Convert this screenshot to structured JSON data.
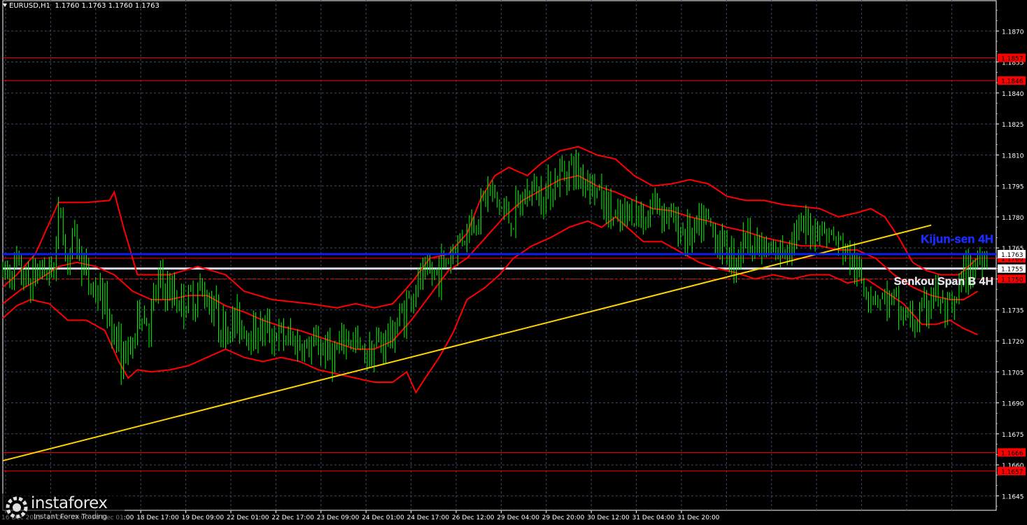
{
  "header": {
    "symbol": "EURUSD,H1",
    "ohlc": "1.1760 1.1763 1.1760 1.1763"
  },
  "watermark": {
    "brand": "instaforex",
    "tagline": "Instant Forex Trading"
  },
  "chart_data": {
    "type": "candlestick",
    "symbol": "EURUSD",
    "timeframe": "H1",
    "ylim": [
      1.1638,
      1.1885
    ],
    "y_ticks": [
      "1.1870",
      "1.1855",
      "1.1840",
      "1.1825",
      "1.1810",
      "1.1795",
      "1.1780",
      "1.1765",
      "1.1750",
      "1.1735",
      "1.1720",
      "1.1705",
      "1.1690",
      "1.1675",
      "1.1660",
      "1.1645"
    ],
    "x_ticks": [
      "16 Dec 2025",
      "17 Dec 09:00",
      "18 Dec 01:00",
      "18 Dec 17:00",
      "19 Dec 09:00",
      "22 Dec 01:00",
      "22 Dec 17:00",
      "23 Dec 09:00",
      "24 Dec 01:00",
      "24 Dec 17:00",
      "26 Dec 12:00",
      "29 Dec 04:00",
      "29 Dec 20:00",
      "30 Dec 12:00",
      "31 Dec 04:00",
      "31 Dec 20:00"
    ],
    "price_curve": [
      {
        "t": 0,
        "p": 1.1752
      },
      {
        "t": 3,
        "p": 1.1756
      },
      {
        "t": 6,
        "p": 1.1748
      },
      {
        "t": 9,
        "p": 1.1756
      },
      {
        "t": 11,
        "p": 1.1752
      },
      {
        "t": 13,
        "p": 1.1785
      },
      {
        "t": 14,
        "p": 1.176
      },
      {
        "t": 16,
        "p": 1.177
      },
      {
        "t": 19,
        "p": 1.1748
      },
      {
        "t": 22,
        "p": 1.174
      },
      {
        "t": 24,
        "p": 1.1728
      },
      {
        "t": 26,
        "p": 1.1712
      },
      {
        "t": 28,
        "p": 1.1714
      },
      {
        "t": 30,
        "p": 1.1735
      },
      {
        "t": 32,
        "p": 1.1728
      },
      {
        "t": 34,
        "p": 1.1748
      },
      {
        "t": 37,
        "p": 1.1742
      },
      {
        "t": 40,
        "p": 1.1738
      },
      {
        "t": 43,
        "p": 1.1745
      },
      {
        "t": 46,
        "p": 1.1738
      },
      {
        "t": 48,
        "p": 1.1724
      },
      {
        "t": 51,
        "p": 1.173
      },
      {
        "t": 54,
        "p": 1.1724
      },
      {
        "t": 57,
        "p": 1.1726
      },
      {
        "t": 60,
        "p": 1.1722
      },
      {
        "t": 63,
        "p": 1.172
      },
      {
        "t": 66,
        "p": 1.1716
      },
      {
        "t": 69,
        "p": 1.1718
      },
      {
        "t": 72,
        "p": 1.1713
      },
      {
        "t": 75,
        "p": 1.1722
      },
      {
        "t": 78,
        "p": 1.1714
      },
      {
        "t": 81,
        "p": 1.1718
      },
      {
        "t": 84,
        "p": 1.1722
      },
      {
        "t": 87,
        "p": 1.1735
      },
      {
        "t": 90,
        "p": 1.1748
      },
      {
        "t": 93,
        "p": 1.1752
      },
      {
        "t": 96,
        "p": 1.1758
      },
      {
        "t": 99,
        "p": 1.177
      },
      {
        "t": 102,
        "p": 1.1778
      },
      {
        "t": 105,
        "p": 1.1793
      },
      {
        "t": 107,
        "p": 1.1787
      },
      {
        "t": 110,
        "p": 1.1778
      },
      {
        "t": 112,
        "p": 1.1785
      },
      {
        "t": 114,
        "p": 1.1793
      },
      {
        "t": 117,
        "p": 1.1792
      },
      {
        "t": 120,
        "p": 1.1798
      },
      {
        "t": 122,
        "p": 1.1805
      },
      {
        "t": 125,
        "p": 1.18
      },
      {
        "t": 127,
        "p": 1.1798
      },
      {
        "t": 129,
        "p": 1.179
      },
      {
        "t": 131,
        "p": 1.1783
      },
      {
        "t": 133,
        "p": 1.1776
      },
      {
        "t": 136,
        "p": 1.1783
      },
      {
        "t": 139,
        "p": 1.178
      },
      {
        "t": 141,
        "p": 1.1788
      },
      {
        "t": 143,
        "p": 1.1783
      },
      {
        "t": 146,
        "p": 1.1775
      },
      {
        "t": 149,
        "p": 1.177
      },
      {
        "t": 152,
        "p": 1.1778
      },
      {
        "t": 155,
        "p": 1.1768
      },
      {
        "t": 158,
        "p": 1.176
      },
      {
        "t": 161,
        "p": 1.1772
      },
      {
        "t": 163,
        "p": 1.1766
      },
      {
        "t": 166,
        "p": 1.1761
      },
      {
        "t": 168,
        "p": 1.1763
      },
      {
        "t": 170,
        "p": 1.177
      },
      {
        "t": 173,
        "p": 1.1773
      },
      {
        "t": 176,
        "p": 1.1776
      },
      {
        "t": 179,
        "p": 1.177
      },
      {
        "t": 182,
        "p": 1.1764
      },
      {
        "t": 184,
        "p": 1.1755
      },
      {
        "t": 186,
        "p": 1.1747
      },
      {
        "t": 189,
        "p": 1.1742
      },
      {
        "t": 192,
        "p": 1.1738
      },
      {
        "t": 195,
        "p": 1.1732
      },
      {
        "t": 197,
        "p": 1.1728
      },
      {
        "t": 199,
        "p": 1.1734
      },
      {
        "t": 201,
        "p": 1.1745
      },
      {
        "t": 203,
        "p": 1.1735
      },
      {
        "t": 205,
        "p": 1.1732
      },
      {
        "t": 207,
        "p": 1.1748
      },
      {
        "t": 209,
        "p": 1.1756
      },
      {
        "t": 211,
        "p": 1.176
      },
      {
        "t": 212,
        "p": 1.1763
      }
    ],
    "bollinger_upper": [
      {
        "t": 0,
        "p": 1.1746
      },
      {
        "t": 3,
        "p": 1.1752
      },
      {
        "t": 7,
        "p": 1.1762
      },
      {
        "t": 12,
        "p": 1.1787
      },
      {
        "t": 18,
        "p": 1.1787
      },
      {
        "t": 23,
        "p": 1.1788
      },
      {
        "t": 24,
        "p": 1.1792
      },
      {
        "t": 26,
        "p": 1.1775
      },
      {
        "t": 29,
        "p": 1.1752
      },
      {
        "t": 32,
        "p": 1.1752
      },
      {
        "t": 36,
        "p": 1.1752
      },
      {
        "t": 42,
        "p": 1.1756
      },
      {
        "t": 48,
        "p": 1.1752
      },
      {
        "t": 52,
        "p": 1.1744
      },
      {
        "t": 58,
        "p": 1.174
      },
      {
        "t": 66,
        "p": 1.1738
      },
      {
        "t": 72,
        "p": 1.1736
      },
      {
        "t": 76,
        "p": 1.1738
      },
      {
        "t": 80,
        "p": 1.1736
      },
      {
        "t": 84,
        "p": 1.1738
      },
      {
        "t": 88,
        "p": 1.1748
      },
      {
        "t": 92,
        "p": 1.176
      },
      {
        "t": 96,
        "p": 1.1762
      },
      {
        "t": 100,
        "p": 1.1772
      },
      {
        "t": 103,
        "p": 1.1789
      },
      {
        "t": 106,
        "p": 1.18
      },
      {
        "t": 109,
        "p": 1.1804
      },
      {
        "t": 113,
        "p": 1.18
      },
      {
        "t": 116,
        "p": 1.1806
      },
      {
        "t": 120,
        "p": 1.1812
      },
      {
        "t": 124,
        "p": 1.1814
      },
      {
        "t": 128,
        "p": 1.181
      },
      {
        "t": 132,
        "p": 1.1808
      },
      {
        "t": 136,
        "p": 1.18
      },
      {
        "t": 140,
        "p": 1.1795
      },
      {
        "t": 144,
        "p": 1.1796
      },
      {
        "t": 148,
        "p": 1.1798
      },
      {
        "t": 152,
        "p": 1.1796
      },
      {
        "t": 156,
        "p": 1.179
      },
      {
        "t": 160,
        "p": 1.1788
      },
      {
        "t": 164,
        "p": 1.1788
      },
      {
        "t": 168,
        "p": 1.1786
      },
      {
        "t": 172,
        "p": 1.1785
      },
      {
        "t": 176,
        "p": 1.1784
      },
      {
        "t": 180,
        "p": 1.178
      },
      {
        "t": 184,
        "p": 1.1782
      },
      {
        "t": 187,
        "p": 1.1784
      },
      {
        "t": 190,
        "p": 1.178
      },
      {
        "t": 193,
        "p": 1.177
      },
      {
        "t": 196,
        "p": 1.1758
      },
      {
        "t": 199,
        "p": 1.1754
      },
      {
        "t": 202,
        "p": 1.1752
      },
      {
        "t": 206,
        "p": 1.1752
      },
      {
        "t": 208,
        "p": 1.1756
      },
      {
        "t": 210,
        "p": 1.176
      }
    ],
    "bollinger_middle": [
      {
        "t": 0,
        "p": 1.1738
      },
      {
        "t": 4,
        "p": 1.1745
      },
      {
        "t": 8,
        "p": 1.175
      },
      {
        "t": 12,
        "p": 1.1756
      },
      {
        "t": 16,
        "p": 1.1758
      },
      {
        "t": 20,
        "p": 1.1756
      },
      {
        "t": 24,
        "p": 1.1752
      },
      {
        "t": 28,
        "p": 1.1744
      },
      {
        "t": 32,
        "p": 1.174
      },
      {
        "t": 36,
        "p": 1.174
      },
      {
        "t": 40,
        "p": 1.1742
      },
      {
        "t": 44,
        "p": 1.1742
      },
      {
        "t": 48,
        "p": 1.1737
      },
      {
        "t": 52,
        "p": 1.1734
      },
      {
        "t": 56,
        "p": 1.173
      },
      {
        "t": 60,
        "p": 1.1727
      },
      {
        "t": 64,
        "p": 1.1725
      },
      {
        "t": 68,
        "p": 1.1722
      },
      {
        "t": 72,
        "p": 1.1719
      },
      {
        "t": 76,
        "p": 1.1716
      },
      {
        "t": 80,
        "p": 1.1716
      },
      {
        "t": 84,
        "p": 1.172
      },
      {
        "t": 88,
        "p": 1.173
      },
      {
        "t": 92,
        "p": 1.1742
      },
      {
        "t": 96,
        "p": 1.1754
      },
      {
        "t": 100,
        "p": 1.176
      },
      {
        "t": 104,
        "p": 1.177
      },
      {
        "t": 108,
        "p": 1.178
      },
      {
        "t": 112,
        "p": 1.1788
      },
      {
        "t": 116,
        "p": 1.1793
      },
      {
        "t": 120,
        "p": 1.1798
      },
      {
        "t": 124,
        "p": 1.18
      },
      {
        "t": 128,
        "p": 1.1795
      },
      {
        "t": 132,
        "p": 1.1792
      },
      {
        "t": 136,
        "p": 1.1788
      },
      {
        "t": 140,
        "p": 1.1784
      },
      {
        "t": 144,
        "p": 1.1783
      },
      {
        "t": 148,
        "p": 1.178
      },
      {
        "t": 152,
        "p": 1.1778
      },
      {
        "t": 156,
        "p": 1.1775
      },
      {
        "t": 160,
        "p": 1.1773
      },
      {
        "t": 164,
        "p": 1.177
      },
      {
        "t": 168,
        "p": 1.1768
      },
      {
        "t": 172,
        "p": 1.1766
      },
      {
        "t": 176,
        "p": 1.1766
      },
      {
        "t": 180,
        "p": 1.1764
      },
      {
        "t": 184,
        "p": 1.1764
      },
      {
        "t": 188,
        "p": 1.176
      },
      {
        "t": 192,
        "p": 1.1752
      },
      {
        "t": 196,
        "p": 1.1746
      },
      {
        "t": 200,
        "p": 1.1742
      },
      {
        "t": 204,
        "p": 1.174
      },
      {
        "t": 207,
        "p": 1.174
      },
      {
        "t": 210,
        "p": 1.1744
      }
    ],
    "bollinger_lower": [
      {
        "t": 0,
        "p": 1.1731
      },
      {
        "t": 3,
        "p": 1.1737
      },
      {
        "t": 6,
        "p": 1.174
      },
      {
        "t": 10,
        "p": 1.1738
      },
      {
        "t": 14,
        "p": 1.173
      },
      {
        "t": 18,
        "p": 1.173
      },
      {
        "t": 22,
        "p": 1.1725
      },
      {
        "t": 25,
        "p": 1.171
      },
      {
        "t": 27,
        "p": 1.1702
      },
      {
        "t": 29,
        "p": 1.1706
      },
      {
        "t": 32,
        "p": 1.1705
      },
      {
        "t": 36,
        "p": 1.1706
      },
      {
        "t": 40,
        "p": 1.1708
      },
      {
        "t": 44,
        "p": 1.1712
      },
      {
        "t": 48,
        "p": 1.1716
      },
      {
        "t": 52,
        "p": 1.1712
      },
      {
        "t": 56,
        "p": 1.171
      },
      {
        "t": 60,
        "p": 1.1712
      },
      {
        "t": 64,
        "p": 1.171
      },
      {
        "t": 68,
        "p": 1.1706
      },
      {
        "t": 72,
        "p": 1.1704
      },
      {
        "t": 76,
        "p": 1.1702
      },
      {
        "t": 80,
        "p": 1.17
      },
      {
        "t": 84,
        "p": 1.17
      },
      {
        "t": 87,
        "p": 1.1705
      },
      {
        "t": 89,
        "p": 1.1695
      },
      {
        "t": 91,
        "p": 1.1702
      },
      {
        "t": 94,
        "p": 1.1712
      },
      {
        "t": 97,
        "p": 1.1724
      },
      {
        "t": 100,
        "p": 1.174
      },
      {
        "t": 104,
        "p": 1.1746
      },
      {
        "t": 107,
        "p": 1.1752
      },
      {
        "t": 110,
        "p": 1.176
      },
      {
        "t": 114,
        "p": 1.1766
      },
      {
        "t": 118,
        "p": 1.177
      },
      {
        "t": 122,
        "p": 1.1775
      },
      {
        "t": 126,
        "p": 1.1778
      },
      {
        "t": 129,
        "p": 1.1775
      },
      {
        "t": 132,
        "p": 1.178
      },
      {
        "t": 135,
        "p": 1.1774
      },
      {
        "t": 138,
        "p": 1.1768
      },
      {
        "t": 142,
        "p": 1.1768
      },
      {
        "t": 146,
        "p": 1.1763
      },
      {
        "t": 150,
        "p": 1.1758
      },
      {
        "t": 154,
        "p": 1.1755
      },
      {
        "t": 158,
        "p": 1.1753
      },
      {
        "t": 162,
        "p": 1.175
      },
      {
        "t": 166,
        "p": 1.1752
      },
      {
        "t": 170,
        "p": 1.175
      },
      {
        "t": 174,
        "p": 1.1752
      },
      {
        "t": 178,
        "p": 1.1752
      },
      {
        "t": 182,
        "p": 1.1748
      },
      {
        "t": 186,
        "p": 1.175
      },
      {
        "t": 190,
        "p": 1.1744
      },
      {
        "t": 194,
        "p": 1.1738
      },
      {
        "t": 198,
        "p": 1.1728
      },
      {
        "t": 201,
        "p": 1.1728
      },
      {
        "t": 204,
        "p": 1.173
      },
      {
        "t": 207,
        "p": 1.1726
      },
      {
        "t": 210,
        "p": 1.1723
      }
    ],
    "trendline": {
      "color": "#ffd200",
      "from": {
        "t": 0,
        "p": 1.1662
      },
      "to": {
        "t": 200,
        "p": 1.1776
      }
    },
    "horizontal_levels": [
      {
        "price": 1.1857,
        "label": "1.1857",
        "color": "#ff0000",
        "label_bg": "#ff0000"
      },
      {
        "price": 1.1846,
        "label": "1.1846",
        "color": "#ff0000",
        "label_bg": "#ff0000"
      },
      {
        "price": 1.176,
        "label": "1.1760",
        "color": "#ff0000",
        "label_bg": "#ff0000"
      },
      {
        "price": 1.175,
        "label": "1.1750",
        "color": "#ff0000",
        "label_bg": "#ff0000",
        "dashed": true
      },
      {
        "price": 1.1666,
        "label": "1.1666",
        "color": "#ff0000",
        "label_bg": "#ff0000"
      },
      {
        "price": 1.1657,
        "label": "1.1657",
        "color": "#ff0000",
        "label_bg": "#ff0000"
      },
      {
        "price": 1.1755,
        "label": "1.1755",
        "color": "#d8d8e8",
        "label_bg": "#ffffff",
        "thick": true
      }
    ],
    "kijun_line": {
      "price": 1.1762,
      "color": "#0a1ef0",
      "label": "Kijun-sen 4H"
    },
    "senkou_label": "Senkou Span B 4H",
    "price_marker": {
      "label": "1.1763",
      "price": 1.1762
    },
    "colors": {
      "background": "#000000",
      "grid": "#3a4a6a",
      "candles": "#00ff00",
      "bollinger": "#ff0000",
      "axis_text": "#ffffff"
    }
  }
}
